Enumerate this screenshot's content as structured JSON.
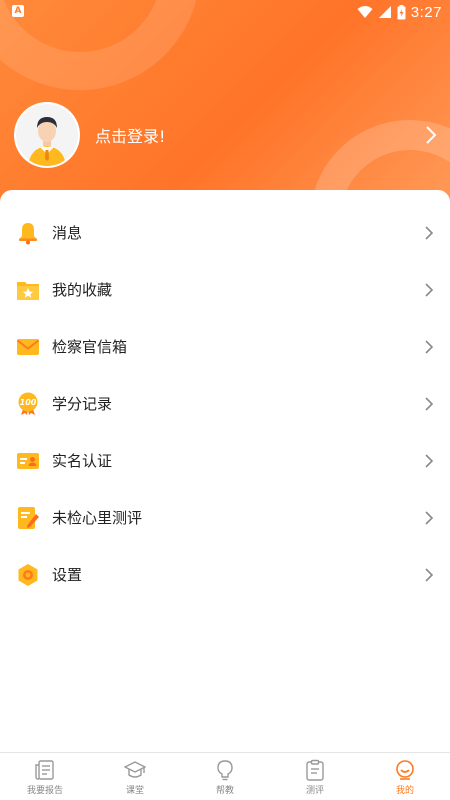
{
  "status_bar": {
    "time": "3:27",
    "notification_badge": "A",
    "icons": [
      "wifi-icon",
      "signal-icon",
      "battery-icon"
    ]
  },
  "profile": {
    "login_prompt": "点击登录!"
  },
  "menu": [
    {
      "label": "消息",
      "icon": "bell-icon"
    },
    {
      "label": "我的收藏",
      "icon": "star-folder-icon"
    },
    {
      "label": "检察官信箱",
      "icon": "mail-icon"
    },
    {
      "label": "学分记录",
      "icon": "score-100-icon"
    },
    {
      "label": "实名认证",
      "icon": "id-card-icon"
    },
    {
      "label": "未检心里测评",
      "icon": "note-edit-icon"
    },
    {
      "label": "设置",
      "icon": "gear-icon"
    }
  ],
  "bottom_nav": [
    {
      "label": "我要报告",
      "icon": "report-icon",
      "active": false
    },
    {
      "label": "课堂",
      "icon": "graduation-cap-icon",
      "active": false
    },
    {
      "label": "帮教",
      "icon": "lightbulb-icon",
      "active": false
    },
    {
      "label": "测评",
      "icon": "clipboard-icon",
      "active": false
    },
    {
      "label": "我的",
      "icon": "smile-face-icon",
      "active": true
    }
  ],
  "colors": {
    "accent": "#ff7a1e",
    "header_start": "#ff8a3a",
    "header_end": "#ff9a58",
    "icon_yellow": "#ffb81e",
    "icon_orange": "#ff6a1e",
    "inactive_nav": "#888888"
  }
}
